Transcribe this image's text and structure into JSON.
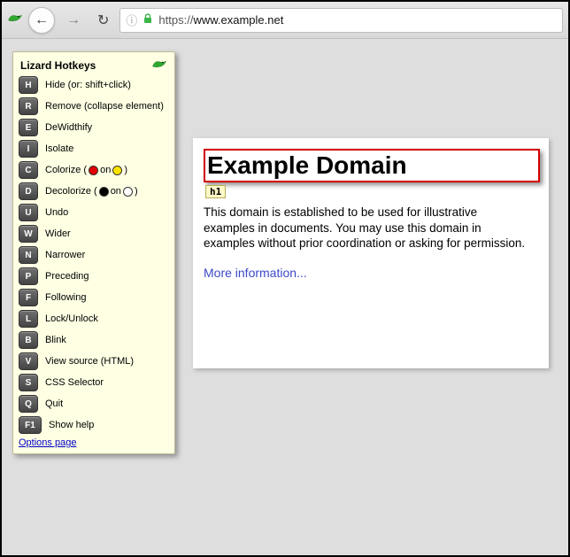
{
  "toolbar": {
    "url_protocol": "https://",
    "url_host": "www.example.net",
    "lock_color": "#3bb54a"
  },
  "panel": {
    "title": "Lizard Hotkeys",
    "options_link": "Options page",
    "items": [
      {
        "key": "H",
        "label": "Hide (or: shift+click)"
      },
      {
        "key": "R",
        "label": "Remove (collapse element)"
      },
      {
        "key": "E",
        "label": "DeWidthify"
      },
      {
        "key": "I",
        "label": "Isolate"
      },
      {
        "key": "C",
        "label_prefix": "Colorize (",
        "dot_a": "red",
        "mid": " on ",
        "dot_b": "yellow",
        "label_suffix": ")"
      },
      {
        "key": "D",
        "label_prefix": "Decolorize (",
        "dot_a": "black",
        "mid": " on ",
        "dot_b": "white",
        "label_suffix": ")"
      },
      {
        "key": "U",
        "label": "Undo"
      },
      {
        "key": "W",
        "label": "Wider"
      },
      {
        "key": "N",
        "label": "Narrower"
      },
      {
        "key": "P",
        "label": "Preceding"
      },
      {
        "key": "F",
        "label": "Following"
      },
      {
        "key": "L",
        "label": "Lock/Unlock"
      },
      {
        "key": "B",
        "label": "Blink"
      },
      {
        "key": "V",
        "label": "View source (HTML)"
      },
      {
        "key": "S",
        "label": "CSS Selector"
      },
      {
        "key": "Q",
        "label": "Quit"
      },
      {
        "key": "F1",
        "label": "Show help",
        "wide": true
      }
    ]
  },
  "content": {
    "heading": "Example Domain",
    "tag_badge": "h1",
    "paragraph": "This domain is established to be used for illustrative examples in documents. You may use this domain in examples without prior coordination or asking for permission.",
    "more_link": "More information..."
  }
}
